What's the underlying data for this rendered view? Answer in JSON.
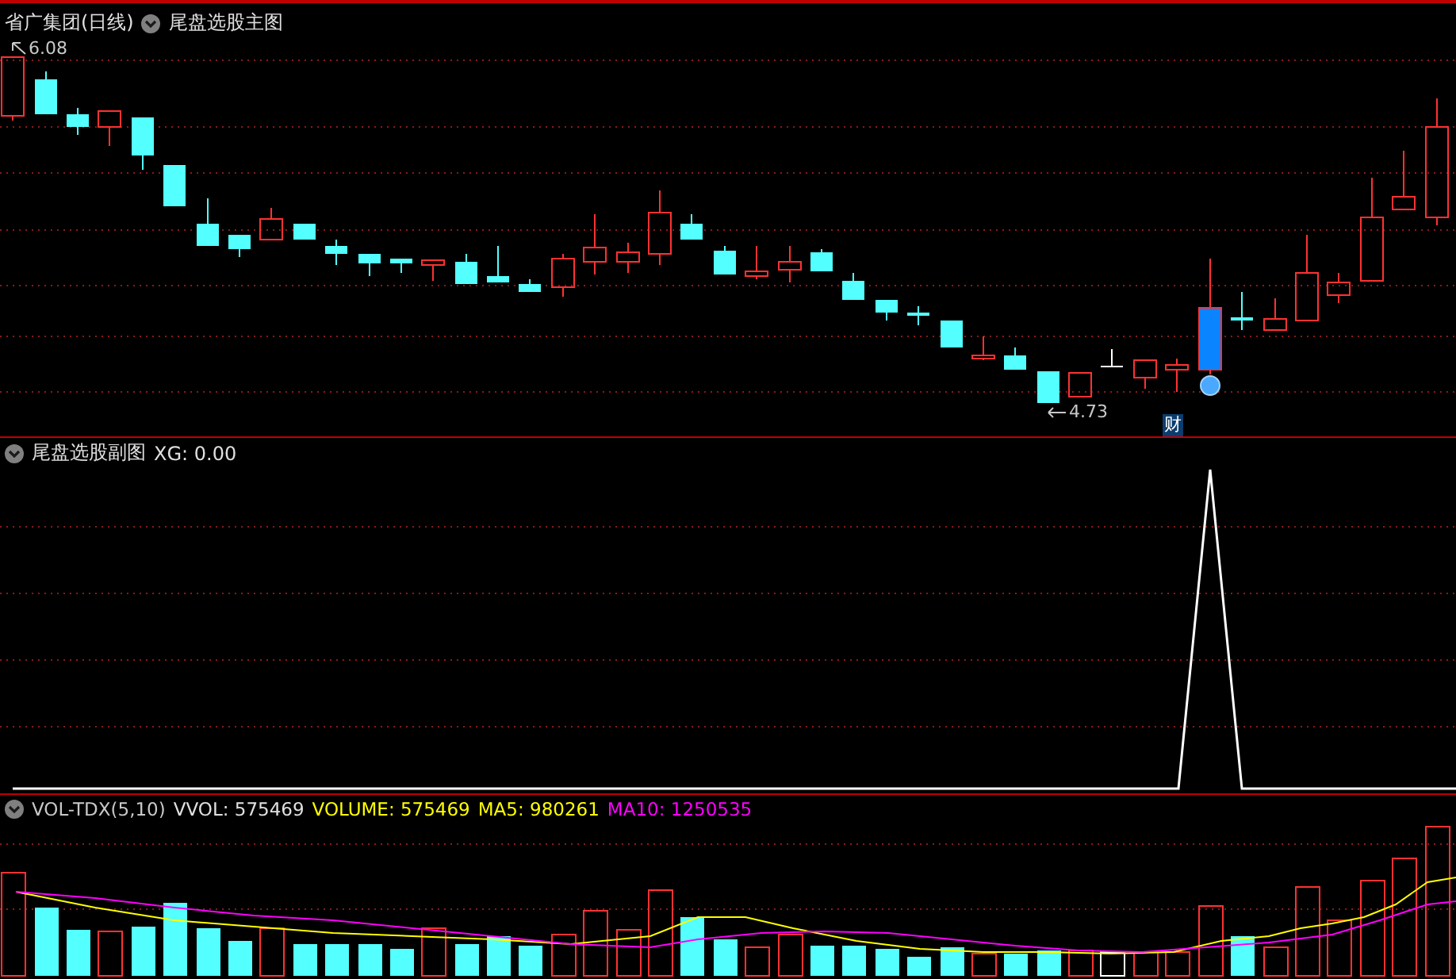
{
  "main_chart": {
    "title": "省广集团(日线)",
    "indicator": "尾盘选股主图",
    "high_label": "6.08",
    "low_label": "4.73",
    "signal_badge": "财"
  },
  "sub_chart": {
    "title": "尾盘选股副图",
    "value": "XG: 0.00"
  },
  "volume_chart": {
    "title": "VOL-TDX(5,10)",
    "readouts": [
      {
        "text": "VVOL: 575469",
        "color": "#e0e0e0"
      },
      {
        "text": "VOLUME: 575469",
        "color": "#ffff00"
      },
      {
        "text": "MA5: 980261",
        "color": "#ffff00"
      },
      {
        "text": "MA10: 1250535",
        "color": "#ff00ff"
      }
    ]
  }
}
